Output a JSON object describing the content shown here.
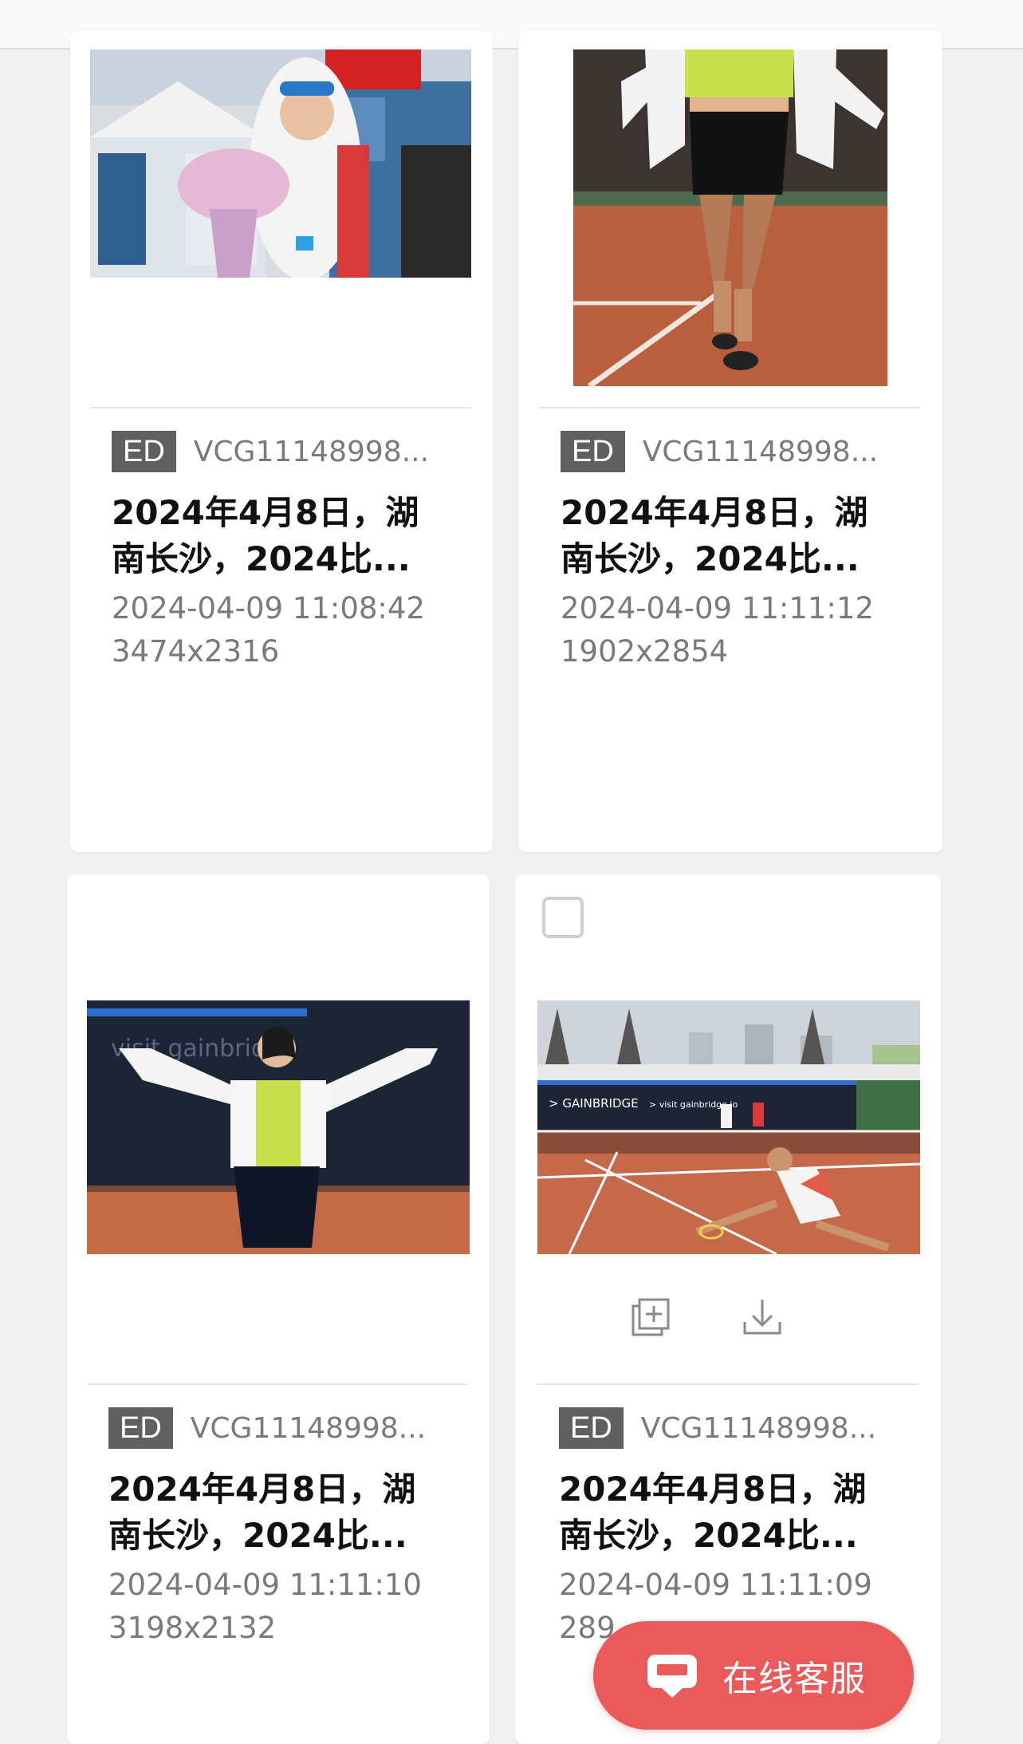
{
  "cards": [
    {
      "badge": "ED",
      "id": "VCG11148998...",
      "title_line1": "2024年4月8日，湖",
      "title_line2": "南长沙，2024比...",
      "timestamp": "2024-04-09 11:08:42",
      "dimensions": "3474x2316"
    },
    {
      "badge": "ED",
      "id": "VCG11148998...",
      "title_line1": "2024年4月8日，湖",
      "title_line2": "南长沙，2024比...",
      "timestamp": "2024-04-09 11:11:12",
      "dimensions": "1902x2854"
    },
    {
      "badge": "ED",
      "id": "VCG11148998...",
      "title_line1": "2024年4月8日，湖",
      "title_line2": "南长沙，2024比...",
      "timestamp": "2024-04-09 11:11:10",
      "dimensions": "3198x2132"
    },
    {
      "badge": "ED",
      "id": "VCG11148998...",
      "title_line1": "2024年4月8日，湖",
      "title_line2": "南长沙，2024比...",
      "timestamp": "2024-04-09 11:11:09",
      "dimensions": "289"
    }
  ],
  "icons": {
    "add_to_collection": "add-to-collection-icon",
    "download": "download-icon",
    "chat": "chat-bubble-icon"
  },
  "customer_service": {
    "label": "在线客服"
  },
  "colors": {
    "accent": "#ea5a5a",
    "badge": "#606060",
    "page_bg": "#f1f1f2"
  }
}
